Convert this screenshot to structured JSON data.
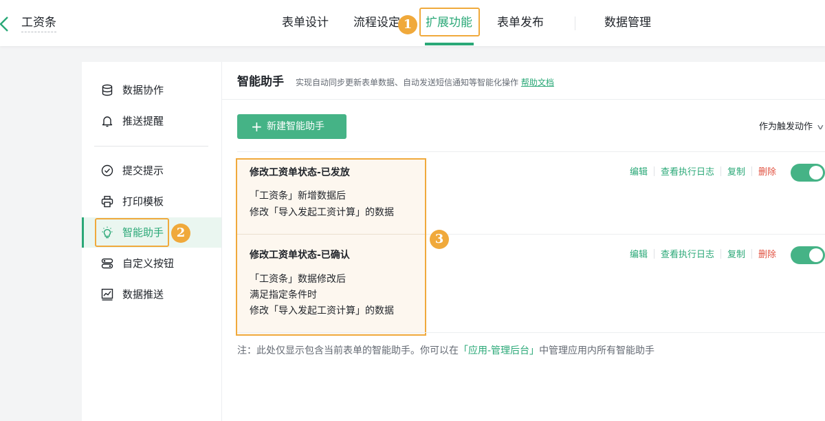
{
  "header": {
    "app_title": "工资条",
    "tabs": [
      {
        "label": "表单设计",
        "active": false
      },
      {
        "label": "流程设定",
        "active": false
      },
      {
        "label": "扩展功能",
        "active": true
      },
      {
        "label": "表单发布",
        "active": false
      },
      {
        "label": "数据管理",
        "active": false
      }
    ]
  },
  "annotations": {
    "badge1": "1",
    "badge2": "2",
    "badge3": "3"
  },
  "sidebar": {
    "items": [
      {
        "label": "数据协作",
        "icon": "database-icon"
      },
      {
        "label": "推送提醒",
        "icon": "bell-icon"
      },
      {
        "label": "提交提示",
        "icon": "check-circle-icon"
      },
      {
        "label": "打印模板",
        "icon": "printer-icon"
      },
      {
        "label": "智能助手",
        "icon": "bulb-icon",
        "active": true
      },
      {
        "label": "自定义按钮",
        "icon": "toggle-buttons-icon"
      },
      {
        "label": "数据推送",
        "icon": "chart-line-icon"
      }
    ]
  },
  "main": {
    "title": "智能助手",
    "description": "实现自动同步更新表单数据、自动发送短信通知等智能化操作",
    "help_link": "帮助文档",
    "new_button": "新建智能助手",
    "trigger_filter": "作为触发动作",
    "actions": {
      "edit": "编辑",
      "log": "查看执行日志",
      "copy": "复制",
      "delete": "删除"
    },
    "assistants": [
      {
        "title": "修改工资单状态-已发放",
        "lines": [
          "「工资条」新增数据后",
          "修改「导入发起工资计算」的数据"
        ],
        "enabled": true
      },
      {
        "title": "修改工资单状态-已确认",
        "lines": [
          "「工资条」数据修改后",
          "满足指定条件时",
          "修改「导入发起工资计算」的数据"
        ],
        "enabled": true
      }
    ],
    "note": {
      "prefix": "注：此处仅显示包含当前表单的智能助手。你可以在",
      "link": "「应用-管理后台」",
      "suffix": "中管理应用内所有智能助手"
    }
  },
  "colors": {
    "accent": "#2aa877",
    "button": "#45b386",
    "highlight": "#f0a93b",
    "danger": "#e15241"
  }
}
